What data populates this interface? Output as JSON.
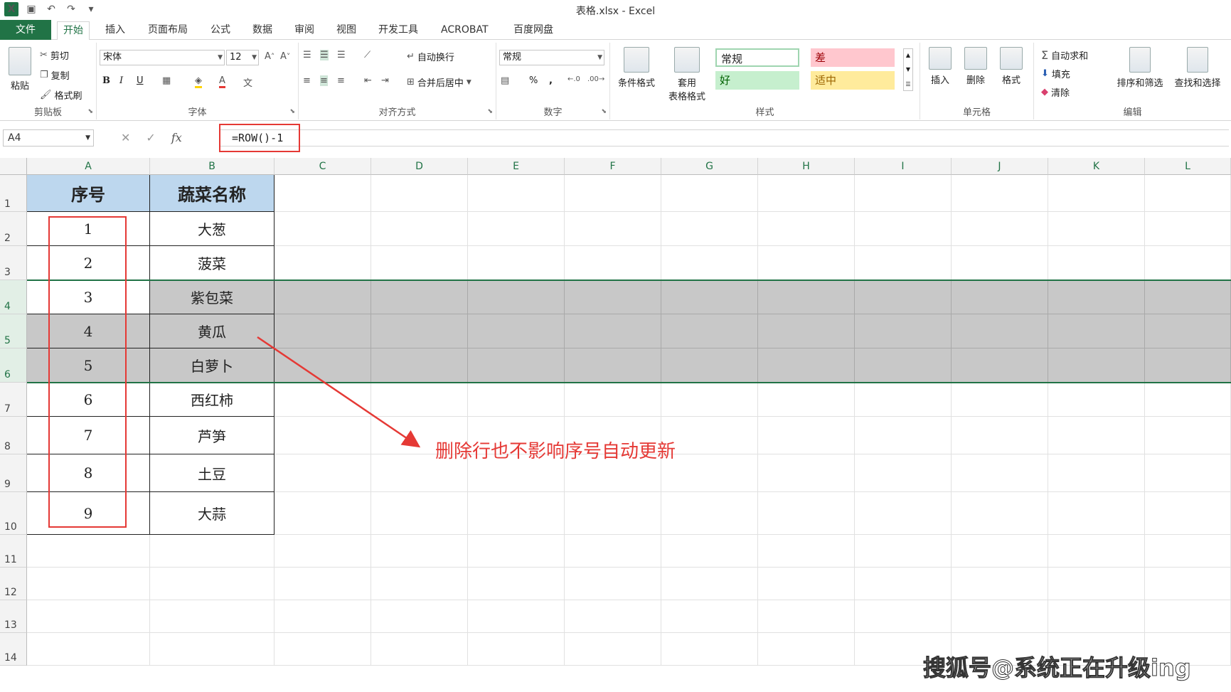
{
  "title": "表格.xlsx - Excel",
  "tabs": [
    "文件",
    "开始",
    "插入",
    "页面布局",
    "公式",
    "数据",
    "审阅",
    "视图",
    "开发工具",
    "ACROBAT",
    "百度网盘"
  ],
  "clipboard": {
    "paste": "粘贴",
    "cut": "剪切",
    "copy": "复制",
    "format_painter": "格式刷",
    "label": "剪贴板"
  },
  "font": {
    "name": "宋体",
    "size": "12",
    "bold": "B",
    "italic": "I",
    "underline": "U",
    "label": "字体"
  },
  "alignment": {
    "wrap": "自动换行",
    "merge": "合并后居中",
    "label": "对齐方式"
  },
  "number": {
    "format": "常规",
    "percent": "%",
    "comma": ",",
    "label": "数字"
  },
  "styles": {
    "conditional": "条件格式",
    "table_format_1": "套用",
    "table_format_2": "表格格式",
    "normal": "常规",
    "bad": "差",
    "good": "好",
    "neutral": "适中",
    "label": "样式"
  },
  "cells": {
    "insert": "插入",
    "delete": "删除",
    "format": "格式",
    "label": "单元格"
  },
  "editing": {
    "autosum": "自动求和",
    "fill": "填充",
    "clear": "清除",
    "sort": "排序和筛选",
    "find": "查找和选择",
    "label": "编辑"
  },
  "formula_bar": {
    "namebox": "A4",
    "formula": "=ROW()-1",
    "fx": "fx"
  },
  "columns": [
    "A",
    "B",
    "C",
    "D",
    "E",
    "F",
    "G",
    "H",
    "I",
    "J",
    "K",
    "L"
  ],
  "rows": [
    "1",
    "2",
    "3",
    "4",
    "5",
    "6",
    "7",
    "8",
    "9",
    "10",
    "11",
    "12",
    "13",
    "14"
  ],
  "table": {
    "headers": [
      "序号",
      "蔬菜名称"
    ],
    "rows": [
      [
        "1",
        "大葱"
      ],
      [
        "2",
        "菠菜"
      ],
      [
        "3",
        "紫包菜"
      ],
      [
        "4",
        "黄瓜"
      ],
      [
        "5",
        "白萝卜"
      ],
      [
        "6",
        "西红柿"
      ],
      [
        "7",
        "芦笋"
      ],
      [
        "8",
        "土豆"
      ],
      [
        "9",
        "大蒜"
      ]
    ]
  },
  "annotation": "删除行也不影响序号自动更新",
  "watermark": "搜狐号@系统正在升级ing",
  "colors": {
    "accent": "#217346",
    "header_fill": "#bdd7ee",
    "highlight": "#e53935",
    "selection": "#c8c8c8"
  }
}
